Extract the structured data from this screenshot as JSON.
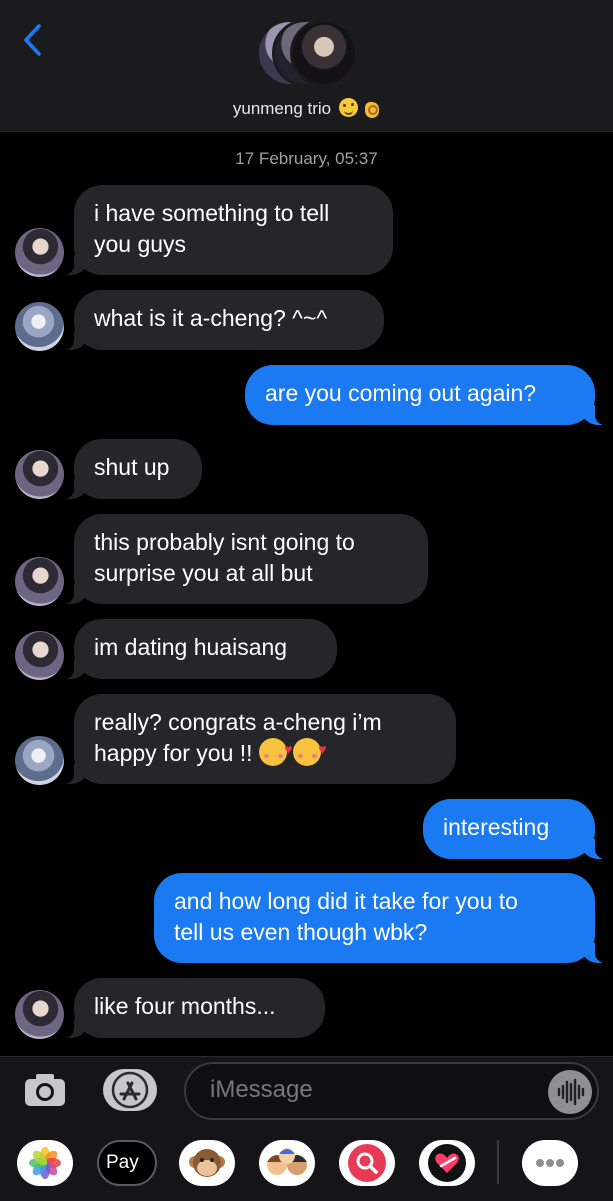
{
  "header": {
    "group_name": "yunmeng trio",
    "name_emojis": [
      "face-icon",
      "ok-hand-icon"
    ],
    "back_icon": "chevron-left-icon"
  },
  "timestamp": "17 February, 05:37",
  "messages": [
    {
      "dir": "in",
      "avatar": "a",
      "text": "i have something to tell\nyou guys"
    },
    {
      "dir": "in",
      "avatar": "b",
      "text": "what is it a-cheng? ^~^"
    },
    {
      "dir": "out",
      "text": "are you coming out again?"
    },
    {
      "dir": "in",
      "avatar": "a",
      "text": "shut up"
    },
    {
      "dir": "in",
      "avatar": "a",
      "text": "this probably isnt going to\nsurprise you at all but"
    },
    {
      "dir": "in",
      "avatar": "a",
      "text": "im dating huaisang"
    },
    {
      "dir": "in",
      "avatar": "b",
      "text": "really? congrats a-cheng i’m\nhappy for you !!",
      "emojis": [
        "smiling-face-with-hearts-icon",
        "smiling-face-with-hearts-icon"
      ]
    },
    {
      "dir": "out",
      "text": "interesting"
    },
    {
      "dir": "out",
      "text": "and how long did it take for you to\ntell us even though wbk?"
    },
    {
      "dir": "in",
      "avatar": "a",
      "text": "like four months..."
    }
  ],
  "composer": {
    "placeholder": "iMessage",
    "camera_icon": "camera-icon",
    "appstore_icon": "app-store-icon",
    "audio_icon": "audio-waveform-icon"
  },
  "app_drawer": {
    "apple_pay_label": "Pay",
    "apps": [
      "photos-icon",
      "apple-pay-icon",
      "monkey-memoji-icon",
      "memoji-stickers-icon",
      "image-search-icon",
      "digital-touch-icon",
      "more-icon"
    ]
  },
  "colors": {
    "incoming_bubble": "#262629",
    "outgoing_bubble": "#1b7af1",
    "background": "#000000",
    "accent": "#1b7af1"
  }
}
